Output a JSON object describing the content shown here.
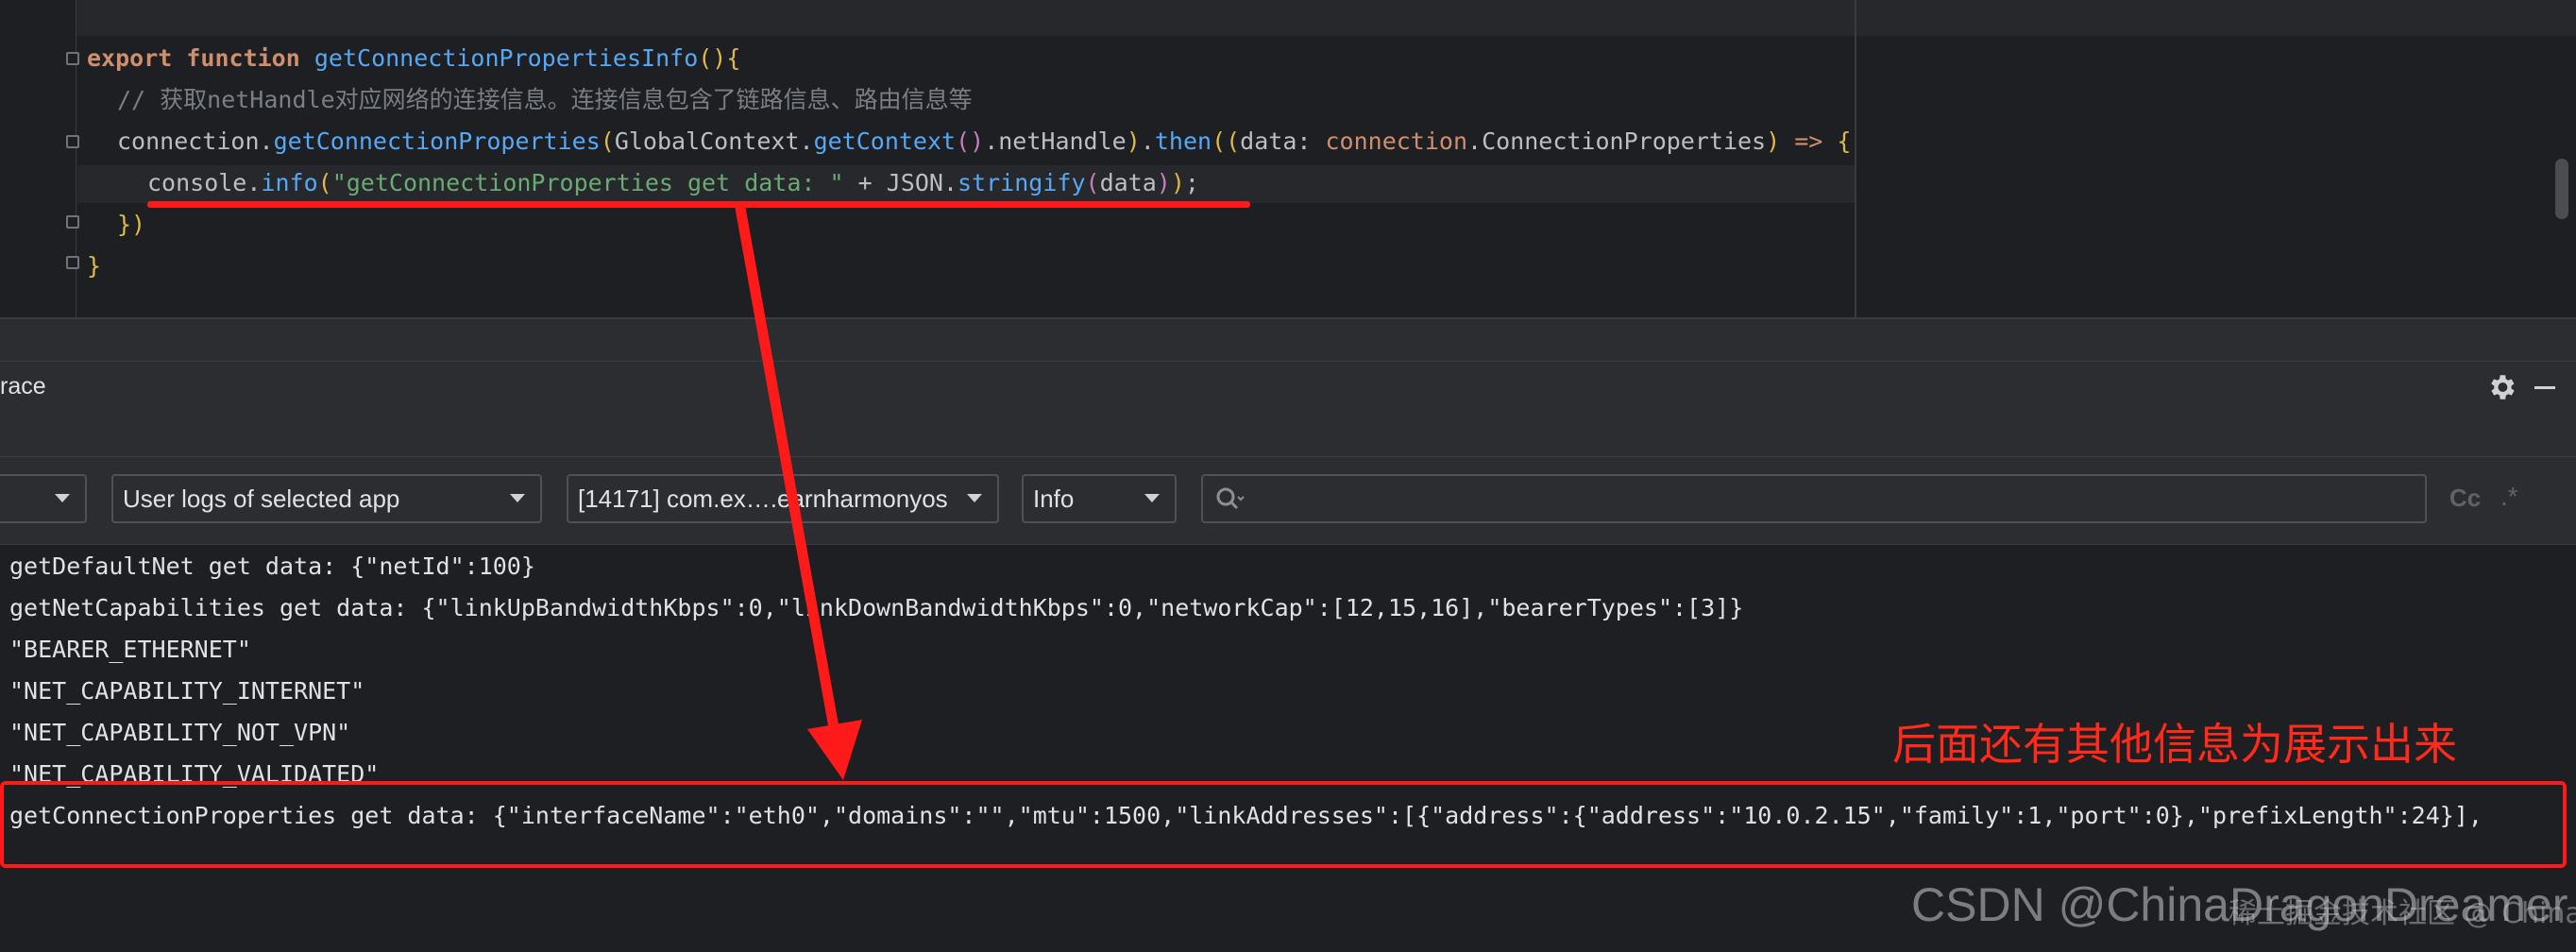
{
  "editor": {
    "line1": {
      "kw1": "export",
      "kw2": "function",
      "fn": "getConnectionPropertiesInfo",
      "paren": "()",
      "brace": "{"
    },
    "comment": "// 获取netHandle对应网络的连接信息。连接信息包含了链路信息、路由信息等",
    "line3": {
      "obj": "connection",
      "method": "getConnectionProperties",
      "ctx": "GlobalContext",
      "getctx": "getContext",
      "prop": "netHandle",
      "then": "then",
      "param": "data",
      "ns": "connection",
      "type": "ConnectionProperties",
      "arrow": "=>"
    },
    "line4": {
      "obj": "console",
      "method": "info",
      "str": "\"getConnectionProperties get data: \"",
      "plus": "+",
      "json": "JSON",
      "stringify": "stringify",
      "arg": "data"
    },
    "line5": "})",
    "line6": "}"
  },
  "panel": {
    "title": "race",
    "filter_device": "",
    "filter_logs": "User logs of selected app",
    "filter_process": "[14171] com.ex….earnharmonyos",
    "filter_level": "Info",
    "search_placeholder": "",
    "case_label": "Cc",
    "regex_label": ".*"
  },
  "logs": [
    "getDefaultNet get data: {\"netId\":100}",
    "getNetCapabilities get data: {\"linkUpBandwidthKbps\":0,\"linkDownBandwidthKbps\":0,\"networkCap\":[12,15,16],\"bearerTypes\":[3]}",
    "\"BEARER_ETHERNET\"",
    "\"NET_CAPABILITY_INTERNET\"",
    "\"NET_CAPABILITY_NOT_VPN\"",
    "\"NET_CAPABILITY_VALIDATED\"",
    "getConnectionProperties get data: {\"interfaceName\":\"eth0\",\"domains\":\"\",\"mtu\":1500,\"linkAddresses\":[{\"address\":{\"address\":\"10.0.2.15\",\"family\":1,\"port\":0},\"prefixLength\":24}],"
  ],
  "annotation": "后面还有其他信息为展示出来",
  "watermark": "CSDN @ChinaDragonDreamer",
  "watermark_overlay": "稀土掘金技术社区 @ ChinaDragon",
  "colors": {
    "accent_red": "#ff1a1a",
    "editor_bg": "#1e1f22",
    "panel_bg": "#2b2d30"
  }
}
